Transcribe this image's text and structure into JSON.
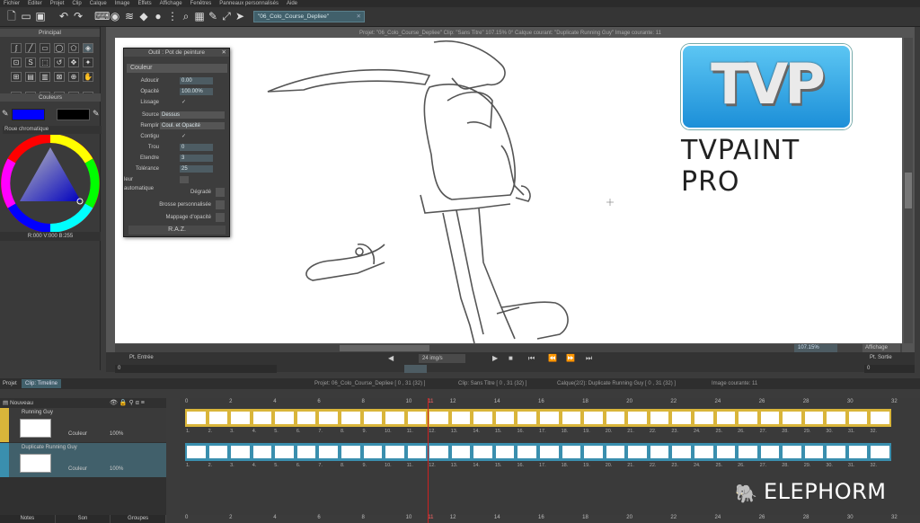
{
  "menu": [
    "Fichier",
    "Editer",
    "Projet",
    "Clip",
    "Calque",
    "Image",
    "Effets",
    "Affichage",
    "Fenêtres",
    "Panneaux personnalisés",
    "Aide"
  ],
  "doc_tab": "\"06_Colo_Course_Depliee\"",
  "left": {
    "principal_title": "Principal",
    "couleurs_title": "Couleurs",
    "wheel_mode": "Roue chromatique",
    "rgb_readout": "R:000 V:000 B:255",
    "primary_color": "#0000ff",
    "secondary_color": "#000000"
  },
  "canvas_info": "Projet: \"06_Colo_Course_Depliee\"  Clip: \"Sans Titre\"  107.15%  0°  Calque courant: \"Duplicate Running Guy\"  Image courante: 11",
  "tool_window": {
    "title": "Outil : Pot de peinture",
    "section": "Couleur",
    "adoucir_label": "Adoucir",
    "adoucir_value": "0.00",
    "opacite_label": "Opacité",
    "opacite_value": "100.00%",
    "lissage_label": "Lissage",
    "source_label": "Source",
    "source_value": "Dessus",
    "remplir_label": "Remplir",
    "remplir_value": "Coul. et Opacité",
    "contigu_label": "Contigu",
    "trou_label": "Trou",
    "trou_value": "0",
    "etendre_label": "Etendre",
    "etendre_value": "3",
    "tolerance_label": "Tolérance",
    "tolerance_value": "25",
    "auto_label": "leur automatique",
    "degrade": "Dégradé",
    "brosse": "Brosse personnalisée",
    "mappage": "Mappage d'opacité",
    "raz": "R.A.Z."
  },
  "logo_text": "TVP",
  "brand_text": "TVPAINT PRO",
  "status": {
    "pt_entree": "Pt. Entrée",
    "pt_sortie": "Pt. Sortie",
    "zoom": "107.15%",
    "affichage": "Affichage",
    "fps": "24 img/s",
    "in_frame": "0",
    "out_frame": "0"
  },
  "timeline": {
    "tab_projet": "Projet",
    "tab_clip": "Clip: Timeline",
    "hdr_projet": "Projet: 06_Colo_Course_Depliee [ 0 , 31  (32) ]",
    "hdr_clip": "Clip: Sans Titre [ 0 , 31  (32) ]",
    "hdr_calque": "Calque(2/2): Duplicate Running Guy [ 0 , 31  (32) ]",
    "hdr_image": "Image courante: 11",
    "nouveau": "Nouveau",
    "layers": [
      {
        "name": "Running Guy",
        "couleur": "Couleur",
        "opacity": "100%",
        "color": "#d9b53a"
      },
      {
        "name": "Duplicate Running Guy",
        "couleur": "Couleur",
        "opacity": "100%",
        "color": "#3a8fae"
      }
    ],
    "ruler": [
      "0",
      "2",
      "4",
      "6",
      "8",
      "10",
      "11",
      "12",
      "14",
      "16",
      "18",
      "20",
      "22",
      "24",
      "26",
      "28",
      "30",
      "32"
    ],
    "frames": [
      "1.",
      "2.",
      "3.",
      "4.",
      "5.",
      "6.",
      "7.",
      "8.",
      "9.",
      "10.",
      "11.",
      "12.",
      "13.",
      "14.",
      "15.",
      "16.",
      "17.",
      "18.",
      "19.",
      "20.",
      "21.",
      "22.",
      "23.",
      "24.",
      "25.",
      "26.",
      "27.",
      "28.",
      "29.",
      "30.",
      "31.",
      "32."
    ]
  },
  "bottom_tabs": [
    "Notes",
    "Son",
    "Groupes"
  ],
  "elephorm": "ELEPHORM"
}
